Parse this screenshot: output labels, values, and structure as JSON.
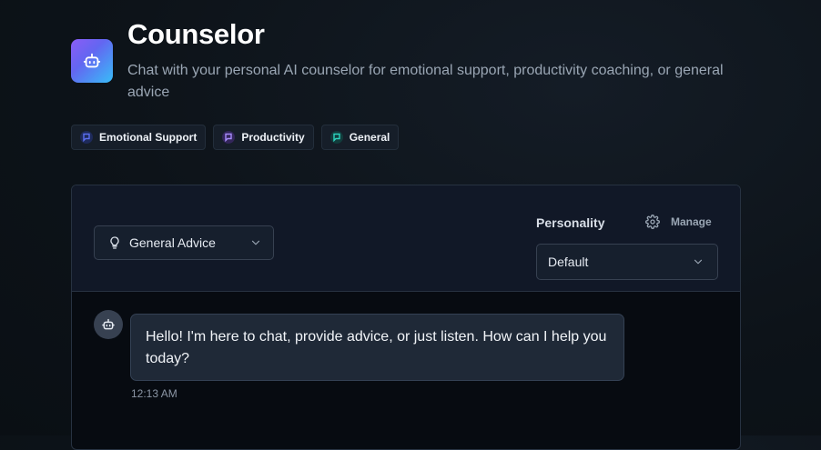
{
  "app": {
    "title": "Counselor",
    "subtitle": "Chat with your personal AI counselor for emotional support, productivity coaching, or general advice",
    "icon": "robot-icon"
  },
  "tags": [
    {
      "label": "Emotional Support",
      "icon": "chat-icon",
      "color": "#3b4fd8"
    },
    {
      "label": "Productivity",
      "icon": "chat-icon",
      "color": "#8b5cf6"
    },
    {
      "label": "General",
      "icon": "chat-icon",
      "color": "#14b8a6"
    }
  ],
  "chat": {
    "mode_select": {
      "icon": "lightbulb-icon",
      "value": "General Advice"
    },
    "personality": {
      "label": "Personality",
      "manage_label": "Manage",
      "manage_icon": "gear-icon",
      "value": "Default"
    },
    "messages": [
      {
        "sender_icon": "robot-icon",
        "text": "Hello! I'm here to chat, provide advice, or just listen. How can I help you today?",
        "time": "12:13 AM"
      }
    ]
  },
  "colors": {
    "accent_gradient_start": "#8b5cf6",
    "accent_gradient_end": "#38bdf8",
    "panel_header": "#111827",
    "bubble": "#1f2937"
  }
}
